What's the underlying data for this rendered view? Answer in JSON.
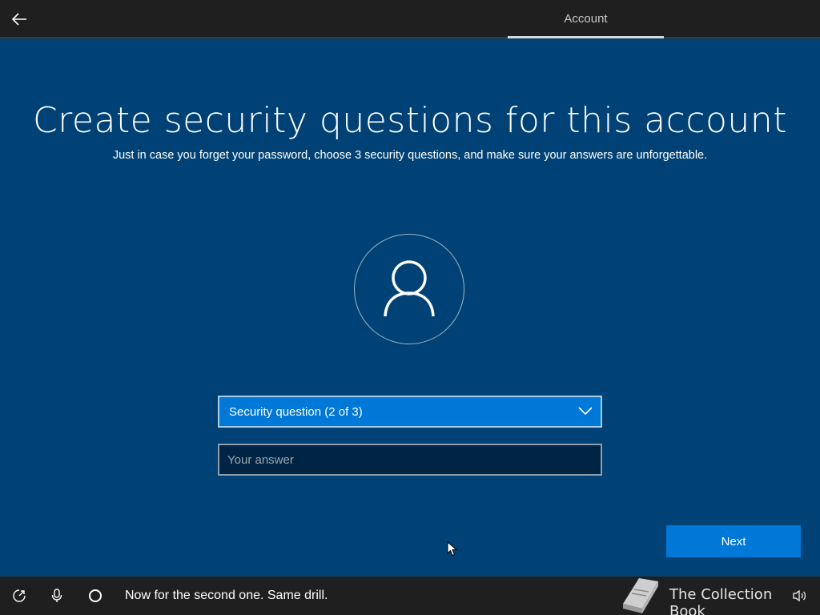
{
  "header": {
    "active_tab": "Account"
  },
  "main": {
    "title": "Create security questions for this account",
    "subtitle": "Just in case you forget your password, choose 3 security questions, and make sure your answers are unforgettable.",
    "question_select": {
      "label": "Security question (2 of 3)"
    },
    "answer_input": {
      "placeholder": "Your answer",
      "value": ""
    },
    "next_label": "Next"
  },
  "footer": {
    "caption": "Now for the second one. Same drill.",
    "watermark_text": "The Collection Book"
  },
  "colors": {
    "background": "#004275",
    "accent": "#0078d7",
    "topbar": "#1f1f1f",
    "input_background": "#002444"
  },
  "icons": {
    "back": "arrow-left-icon",
    "avatar": "user-icon",
    "dropdown": "chevron-down-icon",
    "accessibility": "ease-of-access-icon",
    "microphone": "microphone-icon",
    "cortana": "cortana-circle-icon",
    "volume": "volume-icon"
  }
}
